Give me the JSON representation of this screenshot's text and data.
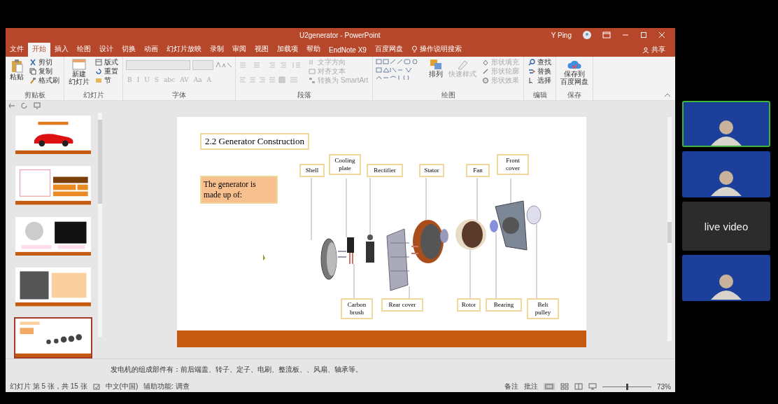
{
  "window": {
    "title": "U2generator - PowerPoint",
    "user": "Y Ping",
    "share": "共享"
  },
  "tabs": [
    {
      "label": "文件",
      "selected": false
    },
    {
      "label": "开始",
      "selected": true
    },
    {
      "label": "插入",
      "selected": false
    },
    {
      "label": "绘图",
      "selected": false
    },
    {
      "label": "设计",
      "selected": false
    },
    {
      "label": "切换",
      "selected": false
    },
    {
      "label": "动画",
      "selected": false
    },
    {
      "label": "幻灯片放映",
      "selected": false
    },
    {
      "label": "录制",
      "selected": false
    },
    {
      "label": "审阅",
      "selected": false
    },
    {
      "label": "视图",
      "selected": false
    },
    {
      "label": "加载项",
      "selected": false
    },
    {
      "label": "帮助",
      "selected": false
    },
    {
      "label": "EndNote X9",
      "selected": false
    },
    {
      "label": "百度网盘",
      "selected": false
    }
  ],
  "tell_me": "操作说明搜索",
  "ribbon": [
    {
      "kind": "clipboard",
      "label": "剪贴板",
      "big": "粘贴",
      "items": [
        "剪切",
        "复制",
        "格式刷"
      ]
    },
    {
      "kind": "slides",
      "label": "幻灯片",
      "big": [
        "新建",
        "幻灯片"
      ],
      "items": [
        "版式",
        "重置",
        "节"
      ]
    },
    {
      "kind": "font",
      "label": "字体",
      "items": [
        "B",
        "I",
        "U",
        "S",
        "abc",
        "AV",
        "Aa",
        "A"
      ]
    },
    {
      "kind": "paragraph",
      "label": "段落",
      "items": [
        "文字方向",
        "对齐文本",
        "转换为 SmartArt"
      ]
    },
    {
      "kind": "drawing",
      "label": "绘图",
      "big": "排列",
      "big2": "快速样式",
      "items": [
        "形状填充",
        "形状轮廓",
        "形状效果"
      ]
    },
    {
      "kind": "editing",
      "label": "编辑",
      "items": [
        "查找",
        "替换",
        "选择"
      ]
    },
    {
      "kind": "save",
      "label": "保存",
      "big": [
        "保存到",
        "百度网盘"
      ]
    }
  ],
  "slides": [
    {
      "selected": false,
      "kind": "title"
    },
    {
      "selected": false,
      "kind": "grid"
    },
    {
      "selected": false,
      "kind": "images"
    },
    {
      "selected": false,
      "kind": "photo"
    },
    {
      "selected": true,
      "kind": "diagram"
    }
  ],
  "slide": {
    "title": "2.2 Generator Construction",
    "intro": "The generator is made up of:",
    "labels": [
      "Shell",
      "Cooling plate",
      "Rectifier",
      "Stator",
      "Fan",
      "Front cover",
      "Carbon brush",
      "Rear cover",
      "Rotor",
      "Bearing",
      "Belt pulley"
    ]
  },
  "notes": "发电机的组成部件有：前后端盖、转子、定子、电刷、整流板、、风扇、轴承等。",
  "status_bar": {
    "slide_count": "幻灯片 第 5 张，共 15 张",
    "language": "中文(中国)",
    "accessibility": "辅助功能: 调查",
    "notes": "备注",
    "comments": "批注",
    "zoom": {
      "level": 0.5
    },
    "zoom_text": "73%"
  },
  "participants": [
    {
      "kind": "video",
      "active": true
    },
    {
      "kind": "video",
      "active": false
    },
    {
      "kind": "label",
      "text": "live video",
      "active": false
    },
    {
      "kind": "video",
      "active": false
    }
  ]
}
